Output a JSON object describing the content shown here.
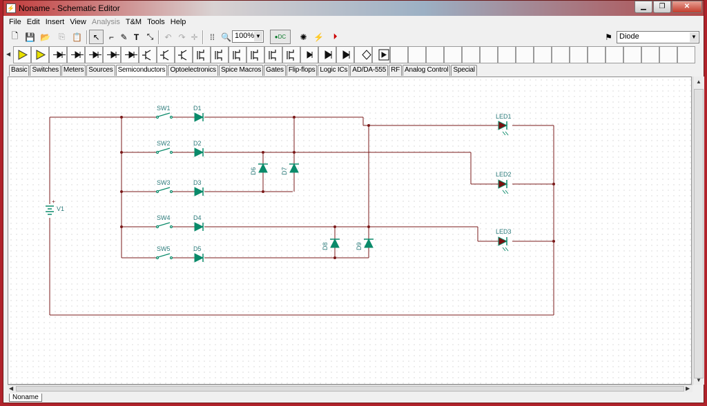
{
  "window": {
    "title": "Noname - Schematic Editor"
  },
  "menu": [
    "File",
    "Edit",
    "Insert",
    "View",
    "Analysis",
    "T&M",
    "Tools",
    "Help"
  ],
  "toolbar": {
    "zoom": "100%",
    "component_select": "Diode",
    "dc_label": "DC"
  },
  "palette_tabs": [
    "Basic",
    "Switches",
    "Meters",
    "Sources",
    "Semiconductors",
    "Optoelectronics",
    "Spice Macros",
    "Gates",
    "Flip-flops",
    "Logic ICs",
    "AD/DA-555",
    "RF",
    "Analog Control",
    "Special"
  ],
  "active_tab": "Semiconductors",
  "schematic": {
    "source": "V1",
    "switches": [
      "SW1",
      "SW2",
      "SW3",
      "SW4",
      "SW5"
    ],
    "diodes": [
      "D1",
      "D2",
      "D3",
      "D4",
      "D5",
      "D6",
      "D7",
      "D8",
      "D9"
    ],
    "leds": [
      "LED1",
      "LED2",
      "LED3"
    ]
  },
  "document_tab": "Noname",
  "colors": {
    "wire": "#7a1818",
    "component": "#0a8a6a",
    "label": "#2a7a7a",
    "title_accent": "#b0232b"
  }
}
